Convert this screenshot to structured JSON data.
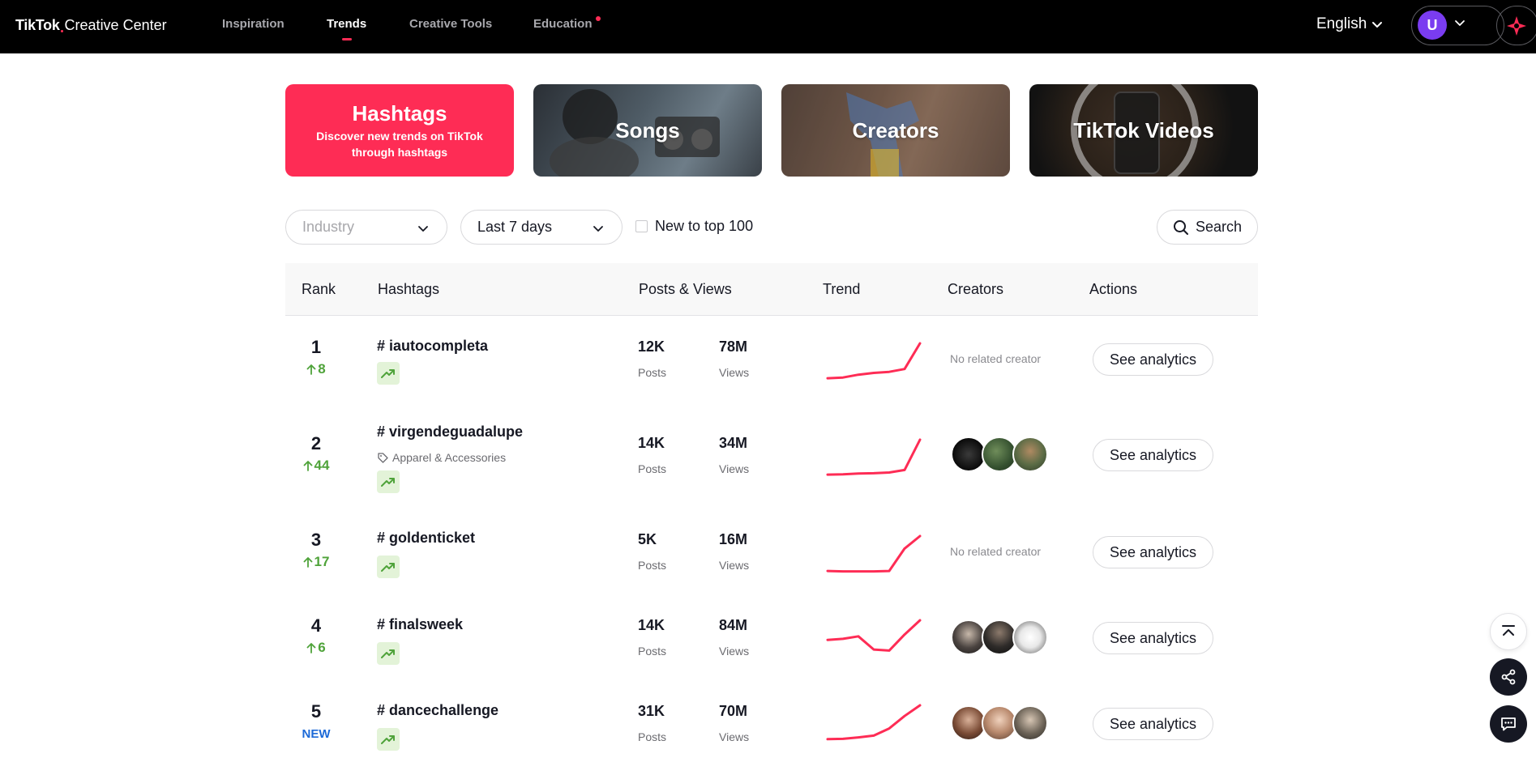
{
  "header": {
    "logo_brand": "TikTok",
    "logo_product": "Creative Center",
    "nav": [
      {
        "label": "Inspiration"
      },
      {
        "label": "Trends"
      },
      {
        "label": "Creative Tools"
      },
      {
        "label": "Education"
      }
    ],
    "active_nav": "Trends",
    "language": "English",
    "user_initial": "U"
  },
  "cards": {
    "hashtags": {
      "title": "Hashtags",
      "subtitle": "Discover new trends on TikTok through hashtags"
    },
    "songs": {
      "title": "Songs"
    },
    "creators": {
      "title": "Creators"
    },
    "videos": {
      "title": "TikTok Videos"
    }
  },
  "filters": {
    "industry_placeholder": "Industry",
    "period": "Last 7 days",
    "new_to_top": "New to top 100",
    "new_to_top_checked": false,
    "search_label": "Search"
  },
  "table": {
    "headers": {
      "rank": "Rank",
      "hashtags": "Hashtags",
      "posts_views": "Posts & Views",
      "trend": "Trend",
      "creators": "Creators",
      "actions": "Actions"
    },
    "posts_unit": "Posts",
    "views_unit": "Views",
    "no_creator_text": "No related creator",
    "action_label": "See analytics",
    "rows": [
      {
        "rank": "1",
        "change": "8",
        "hashtag": "# iautocompleta",
        "industry": "",
        "posts": "12K",
        "views": "78M",
        "has_creators": false,
        "trend": [
          0.02,
          0.04,
          0.12,
          0.17,
          0.2,
          0.28,
          1.0
        ]
      },
      {
        "rank": "2",
        "change": "44",
        "hashtag": "# virgendeguadalupe",
        "industry": "Apparel & Accessories",
        "posts": "14K",
        "views": "34M",
        "has_creators": true,
        "trend": [
          0.02,
          0.03,
          0.05,
          0.06,
          0.08,
          0.15,
          1.0
        ]
      },
      {
        "rank": "3",
        "change": "17",
        "hashtag": "# goldenticket",
        "industry": "",
        "posts": "5K",
        "views": "16M",
        "has_creators": false,
        "trend": [
          0.02,
          0.01,
          0.01,
          0.01,
          0.02,
          0.65,
          1.0
        ]
      },
      {
        "rank": "4",
        "change": "6",
        "hashtag": "# finalsweek",
        "industry": "",
        "posts": "14K",
        "views": "84M",
        "has_creators": true,
        "trend": [
          0.45,
          0.48,
          0.55,
          0.18,
          0.15,
          0.6,
          1.0
        ]
      },
      {
        "rank": "5",
        "change": "NEW",
        "hashtag": "# dancechallenge",
        "industry": "",
        "posts": "31K",
        "views": "70M",
        "has_creators": true,
        "trend": [
          0.05,
          0.06,
          0.1,
          0.15,
          0.35,
          0.7,
          1.0
        ]
      }
    ]
  },
  "colors": {
    "accent": "#fe2c55",
    "rank_up": "#4fa33a",
    "rank_new": "#1d6ad8",
    "trend_line": "#fe2c55"
  }
}
